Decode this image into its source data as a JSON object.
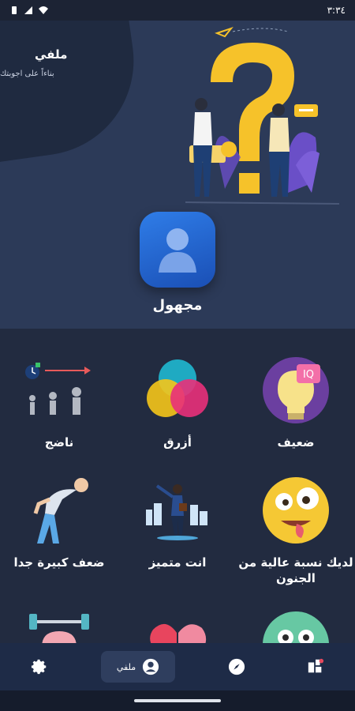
{
  "status_bar": {
    "time": "٣:٣٤"
  },
  "profile": {
    "name": "ملفي",
    "subtitle": "بناءاً على اجوبتك",
    "status_label": "مجهول"
  },
  "results": [
    {
      "label": "ضعيف",
      "icon": "iq-lightbulb-icon"
    },
    {
      "label": "أزرق",
      "icon": "color-circles-icon"
    },
    {
      "label": "ناضج",
      "icon": "growth-people-icon"
    },
    {
      "label": "لديك نسبة عالية من الجنون",
      "icon": "crazy-face-icon"
    },
    {
      "label": "انت متميز",
      "icon": "businessman-city-icon"
    },
    {
      "label": "ضعف كبيرة جدا",
      "icon": "tired-man-icon"
    },
    {
      "label": "",
      "icon": "dizzy-face-icon"
    },
    {
      "label": "",
      "icon": "brain-heart-icon"
    },
    {
      "label": "",
      "icon": "brain-barbell-icon"
    }
  ],
  "nav": {
    "items": [
      {
        "name": "home",
        "icon": "dashboard-icon"
      },
      {
        "name": "explore",
        "icon": "compass-icon"
      },
      {
        "name": "profile",
        "icon": "user-icon",
        "label": "ملفي",
        "active": true
      },
      {
        "name": "settings",
        "icon": "gear-icon"
      }
    ]
  },
  "colors": {
    "background": "#222b40",
    "header": "#2c3a58",
    "nav": "#1e2b47",
    "accent": "#2f7de8"
  }
}
